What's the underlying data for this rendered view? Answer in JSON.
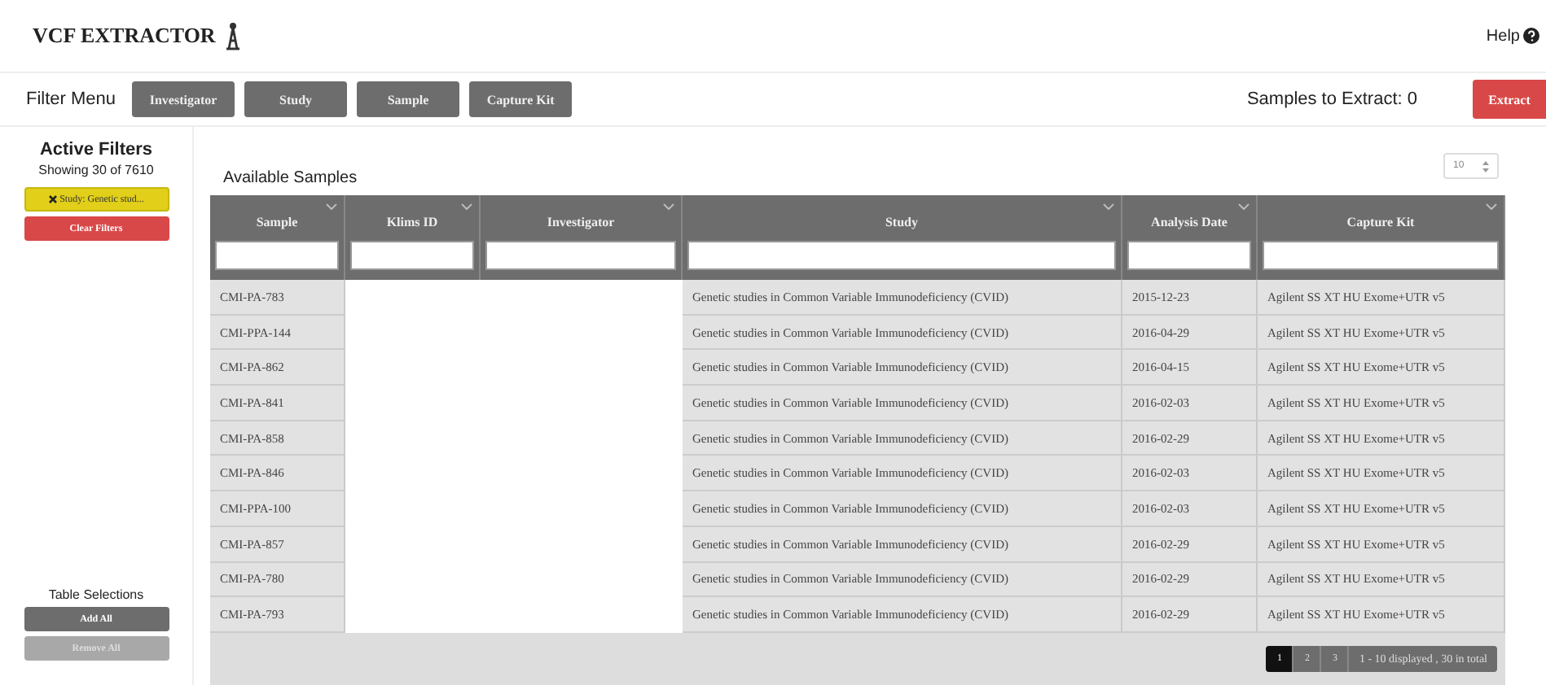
{
  "app": {
    "title": "VCF EXTRACTOR",
    "help": "Help"
  },
  "filter_menu": {
    "label": "Filter Menu",
    "buttons": [
      "Investigator",
      "Study",
      "Sample",
      "Capture Kit"
    ],
    "samples_to_extract": "Samples to Extract: 0",
    "extract_button": "Extract"
  },
  "sidebar": {
    "active_filters_title": "Active Filters",
    "showing": "Showing 30 of 7610",
    "filters": [
      {
        "label": "Study: Genetic stud..."
      }
    ],
    "clear_button": "Clear Filters",
    "table_selections_title": "Table Selections",
    "add_all": "Add All",
    "remove_all": {
      "label": "Remove All",
      "disabled": true
    }
  },
  "table": {
    "title": "Available Samples",
    "page_size": "10",
    "columns": [
      "Sample",
      "Klims ID",
      "Investigator",
      "Study",
      "Analysis Date",
      "Capture Kit"
    ],
    "rows": [
      {
        "sample": "CMI-PA-783",
        "study": "Genetic studies in Common Variable Immunodeficiency (CVID)",
        "date": "2015-12-23",
        "kit": "Agilent SS XT HU Exome+UTR v5"
      },
      {
        "sample": "CMI-PPA-144",
        "study": "Genetic studies in Common Variable Immunodeficiency (CVID)",
        "date": "2016-04-29",
        "kit": "Agilent SS XT HU Exome+UTR v5"
      },
      {
        "sample": "CMI-PA-862",
        "study": "Genetic studies in Common Variable Immunodeficiency (CVID)",
        "date": "2016-04-15",
        "kit": "Agilent SS XT HU Exome+UTR v5"
      },
      {
        "sample": "CMI-PA-841",
        "study": "Genetic studies in Common Variable Immunodeficiency (CVID)",
        "date": "2016-02-03",
        "kit": "Agilent SS XT HU Exome+UTR v5"
      },
      {
        "sample": "CMI-PA-858",
        "study": "Genetic studies in Common Variable Immunodeficiency (CVID)",
        "date": "2016-02-29",
        "kit": "Agilent SS XT HU Exome+UTR v5"
      },
      {
        "sample": "CMI-PA-846",
        "study": "Genetic studies in Common Variable Immunodeficiency (CVID)",
        "date": "2016-02-03",
        "kit": "Agilent SS XT HU Exome+UTR v5"
      },
      {
        "sample": "CMI-PPA-100",
        "study": "Genetic studies in Common Variable Immunodeficiency (CVID)",
        "date": "2016-02-03",
        "kit": "Agilent SS XT HU Exome+UTR v5"
      },
      {
        "sample": "CMI-PA-857",
        "study": "Genetic studies in Common Variable Immunodeficiency (CVID)",
        "date": "2016-02-29",
        "kit": "Agilent SS XT HU Exome+UTR v5"
      },
      {
        "sample": "CMI-PA-780",
        "study": "Genetic studies in Common Variable Immunodeficiency (CVID)",
        "date": "2016-02-29",
        "kit": "Agilent SS XT HU Exome+UTR v5"
      },
      {
        "sample": "CMI-PA-793",
        "study": "Genetic studies in Common Variable Immunodeficiency (CVID)",
        "date": "2016-02-29",
        "kit": "Agilent SS XT HU Exome+UTR v5"
      }
    ],
    "pages": [
      {
        "label": "1",
        "selected": true
      },
      {
        "label": "2",
        "selected": false
      },
      {
        "label": "3",
        "selected": false
      }
    ],
    "summary": "1 - 10 displayed , 30 in total"
  }
}
